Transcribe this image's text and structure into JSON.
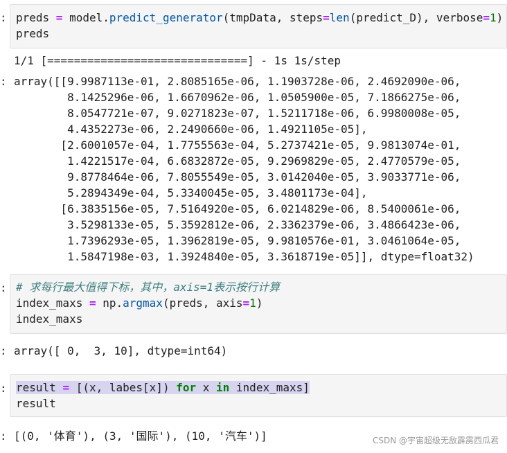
{
  "cell1": {
    "line1": {
      "a": "preds ",
      "op": "=",
      "b": " model.",
      "fn": "predict_generator",
      "c": "(tmpData, steps",
      "op2": "=",
      "fn2": "len",
      "d": "(predict_D), verbose",
      "op3": "=",
      "num": "1",
      "e": ")"
    },
    "line2": "preds"
  },
  "output1": {
    "progress": "1/1 [==============================] - 1s 1s/step",
    "array_lines": [
      "array([[9.9987113e-01, 2.8085165e-06, 1.1903728e-06, 2.4692090e-06,",
      "        8.1425296e-06, 1.6670962e-06, 1.0505900e-05, 7.1866275e-06,",
      "        8.0547721e-07, 9.0271823e-07, 1.5211718e-06, 6.9980008e-05,",
      "        4.4352273e-06, 2.2490660e-06, 1.4921105e-05],",
      "       [2.6001057e-04, 1.7755563e-04, 5.2737421e-05, 9.9813074e-01,",
      "        1.4221517e-04, 6.6832872e-05, 9.2969829e-05, 2.4770579e-05,",
      "        9.8778464e-06, 7.8055549e-05, 3.0142040e-05, 3.9033771e-06,",
      "        5.2894349e-04, 5.3340045e-05, 3.4801173e-04],",
      "       [6.3835156e-05, 7.5164920e-05, 6.0214829e-06, 8.5400061e-06,",
      "        3.5298133e-05, 5.3592812e-06, 2.3362379e-06, 3.4866423e-06,",
      "        1.7396293e-05, 1.3962819e-05, 9.9810576e-01, 3.0461064e-05,",
      "        1.5847198e-03, 1.3924840e-05, 3.3618719e-05]], dtype=float32)"
    ]
  },
  "cell2": {
    "comment": "# 求每行最大值得下标，其中，axis=1表示按行计算",
    "line2": {
      "a": "index_maxs ",
      "op": "=",
      "b": " np.",
      "fn": "argmax",
      "c": "(preds, axis",
      "op2": "=",
      "num": "1",
      "d": ")"
    },
    "line3": "index_maxs"
  },
  "output2": "array([ 0,  3, 10], dtype=int64)",
  "cell3": {
    "line1": {
      "a": "result ",
      "op": "=",
      "b": " [(x, labes[x]) ",
      "kw1": "for",
      "c": " x ",
      "kw2": "in",
      "d": " index_maxs]"
    },
    "line2": "result"
  },
  "output3": "[(0, '体育'), (3, '国际'), (10, '汽车')]",
  "prompt_symbol": ":",
  "watermark": "CSDN @宇宙超级无敌霹雳西瓜君"
}
